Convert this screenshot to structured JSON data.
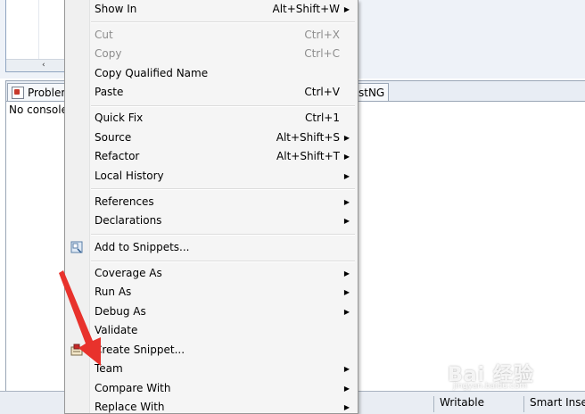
{
  "background": {
    "panel_tab_left": "Problem",
    "panel_tab_right": "stNG",
    "console_text": "No console",
    "scroll_left_arrow": "‹",
    "status": {
      "writable": "Writable",
      "insert_mode": "Smart Inser"
    }
  },
  "menu": {
    "items": [
      {
        "label": "Show In",
        "shortcut": "Alt+Shift+W",
        "submenu": true,
        "disabled": false
      },
      {
        "label": "Cut",
        "shortcut": "Ctrl+X",
        "submenu": false,
        "disabled": true
      },
      {
        "label": "Copy",
        "shortcut": "Ctrl+C",
        "submenu": false,
        "disabled": true
      },
      {
        "label": "Copy Qualified Name",
        "shortcut": "",
        "submenu": false,
        "disabled": false
      },
      {
        "label": "Paste",
        "shortcut": "Ctrl+V",
        "submenu": false,
        "disabled": false
      },
      {
        "label": "Quick Fix",
        "shortcut": "Ctrl+1",
        "submenu": false,
        "disabled": false
      },
      {
        "label": "Source",
        "shortcut": "Alt+Shift+S",
        "submenu": true,
        "disabled": false
      },
      {
        "label": "Refactor",
        "shortcut": "Alt+Shift+T",
        "submenu": true,
        "disabled": false
      },
      {
        "label": "Local History",
        "shortcut": "",
        "submenu": true,
        "disabled": false
      },
      {
        "label": "References",
        "shortcut": "",
        "submenu": true,
        "disabled": false
      },
      {
        "label": "Declarations",
        "shortcut": "",
        "submenu": true,
        "disabled": false
      },
      {
        "label": "Add to Snippets...",
        "shortcut": "",
        "submenu": false,
        "disabled": false,
        "icon": "snippet-add-icon"
      },
      {
        "label": "Coverage As",
        "shortcut": "",
        "submenu": true,
        "disabled": false
      },
      {
        "label": "Run As",
        "shortcut": "",
        "submenu": true,
        "disabled": false
      },
      {
        "label": "Debug As",
        "shortcut": "",
        "submenu": true,
        "disabled": false
      },
      {
        "label": "Validate",
        "shortcut": "",
        "submenu": false,
        "disabled": false
      },
      {
        "label": "Create Snippet...",
        "shortcut": "",
        "submenu": false,
        "disabled": false,
        "icon": "create-snippet-icon"
      },
      {
        "label": "Team",
        "shortcut": "",
        "submenu": true,
        "disabled": false
      },
      {
        "label": "Compare With",
        "shortcut": "",
        "submenu": true,
        "disabled": false
      },
      {
        "label": "Replace With",
        "shortcut": "",
        "submenu": true,
        "disabled": false
      }
    ],
    "submenu_arrow": "▶"
  },
  "annotation": {
    "arrow_color": "#e8322c"
  },
  "watermark": {
    "brand": "Bai 经验",
    "sub": "jingyan.baidu.com"
  }
}
